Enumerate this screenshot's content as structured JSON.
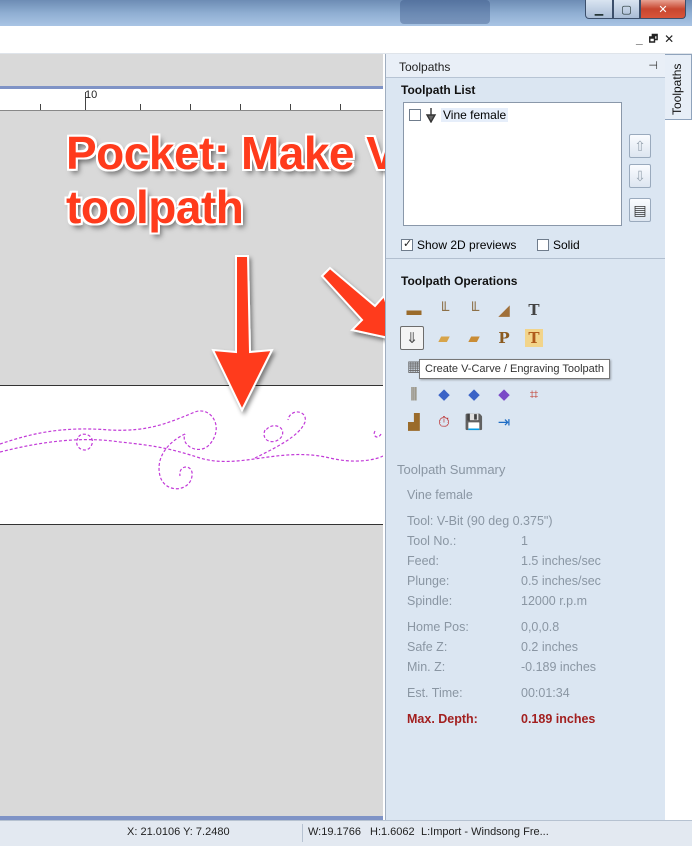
{
  "panel": {
    "title": "Toolpaths",
    "pin_glyph": "⊣",
    "tab_label": "Toolpaths"
  },
  "toolpath_list": {
    "heading": "Toolpath List",
    "items": [
      {
        "label": "Vine female",
        "checked": false,
        "icon": "vbit-icon"
      }
    ],
    "up_glyph": "⇧",
    "down_glyph": "⇩",
    "sheet_glyph": "▤",
    "show_2d_label": "Show 2D previews",
    "show_2d_checked": true,
    "solid_label": "Solid",
    "solid_checked": false
  },
  "operations": {
    "heading": "Toolpath Operations",
    "rows": [
      [
        "▬",
        "╙",
        "╙",
        "◢",
        "T"
      ],
      [
        "⇓",
        "▰",
        "▰",
        "P",
        "T"
      ],
      [
        "▦",
        "",
        "",
        "",
        ""
      ],
      [
        "⫼",
        "◆",
        "◆",
        "◆",
        "⌗"
      ],
      [
        "▟",
        "⏱",
        "💾",
        "⇥"
      ]
    ],
    "tooltip": "Create V-Carve / Engraving  Toolpath"
  },
  "annotation": {
    "line1": "Pocket: Make V-carve",
    "line2": "toolpath"
  },
  "ruler": {
    "label": "10"
  },
  "summary": {
    "heading": "Toolpath Summary",
    "name": "Vine female",
    "tool": "Tool: V-Bit (90 deg 0.375\")",
    "tool_no_label": "Tool No.:",
    "tool_no": "1",
    "feed_label": "Feed:",
    "feed": "1.5 inches/sec",
    "plunge_label": "Plunge:",
    "plunge": "0.5 inches/sec",
    "spindle_label": "Spindle:",
    "spindle": "12000 r.p.m",
    "home_label": "Home Pos:",
    "home": "0,0,0.8",
    "safez_label": "Safe Z:",
    "safez": "0.2 inches",
    "minz_label": "Min. Z:",
    "minz": "-0.189 inches",
    "time_label": "Est. Time:",
    "time": "00:01:34",
    "maxdepth_label": "Max. Depth:",
    "maxdepth": "0.189 inches",
    "maxdepth_color": "#a21f1f"
  },
  "statusbar": {
    "coords": "X: 21.0106 Y:  7.2480",
    "width": "W:19.1766",
    "height": "H:1.6062",
    "layer": "L:Import - Windsong Fre..."
  },
  "window": {
    "min_glyph": "▁",
    "max_glyph": "▢",
    "close_glyph": "✕",
    "mdi_min": "_",
    "mdi_restore": "🗗",
    "mdi_close": "✕"
  },
  "colors": {
    "accent_red": "#ff3b1c",
    "vector_magenta": "#c23bd8",
    "panel_bg": "#dbe6f2"
  }
}
